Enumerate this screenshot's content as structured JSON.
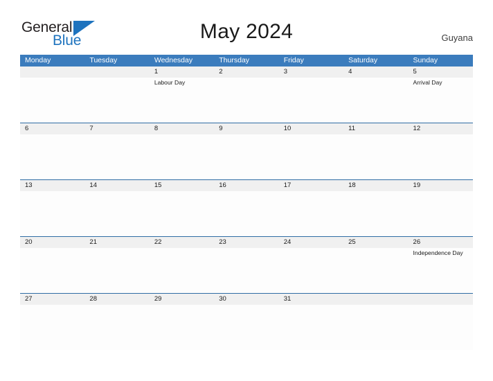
{
  "brand": {
    "name_part1": "General",
    "name_part2": "Blue",
    "accent_color": "#1e73be"
  },
  "header": {
    "title": "May 2024",
    "country": "Guyana"
  },
  "calendar": {
    "header_bg": "#3b7cbd",
    "date_band_bg": "#f0f0f0",
    "divider_color": "#2e6ca4",
    "weekday_headers": [
      "Monday",
      "Tuesday",
      "Wednesday",
      "Thursday",
      "Friday",
      "Saturday",
      "Sunday"
    ],
    "weeks": [
      {
        "days": [
          {
            "date": "",
            "events": []
          },
          {
            "date": "",
            "events": []
          },
          {
            "date": "1",
            "events": [
              "Labour Day"
            ]
          },
          {
            "date": "2",
            "events": []
          },
          {
            "date": "3",
            "events": []
          },
          {
            "date": "4",
            "events": []
          },
          {
            "date": "5",
            "events": [
              "Arrival Day"
            ]
          }
        ]
      },
      {
        "days": [
          {
            "date": "6",
            "events": []
          },
          {
            "date": "7",
            "events": []
          },
          {
            "date": "8",
            "events": []
          },
          {
            "date": "9",
            "events": []
          },
          {
            "date": "10",
            "events": []
          },
          {
            "date": "11",
            "events": []
          },
          {
            "date": "12",
            "events": []
          }
        ]
      },
      {
        "days": [
          {
            "date": "13",
            "events": []
          },
          {
            "date": "14",
            "events": []
          },
          {
            "date": "15",
            "events": []
          },
          {
            "date": "16",
            "events": []
          },
          {
            "date": "17",
            "events": []
          },
          {
            "date": "18",
            "events": []
          },
          {
            "date": "19",
            "events": []
          }
        ]
      },
      {
        "days": [
          {
            "date": "20",
            "events": []
          },
          {
            "date": "21",
            "events": []
          },
          {
            "date": "22",
            "events": []
          },
          {
            "date": "23",
            "events": []
          },
          {
            "date": "24",
            "events": []
          },
          {
            "date": "25",
            "events": []
          },
          {
            "date": "26",
            "events": [
              "Independence Day"
            ]
          }
        ]
      },
      {
        "days": [
          {
            "date": "27",
            "events": []
          },
          {
            "date": "28",
            "events": []
          },
          {
            "date": "29",
            "events": []
          },
          {
            "date": "30",
            "events": []
          },
          {
            "date": "31",
            "events": []
          },
          {
            "date": "",
            "events": []
          },
          {
            "date": "",
            "events": []
          }
        ]
      }
    ]
  }
}
